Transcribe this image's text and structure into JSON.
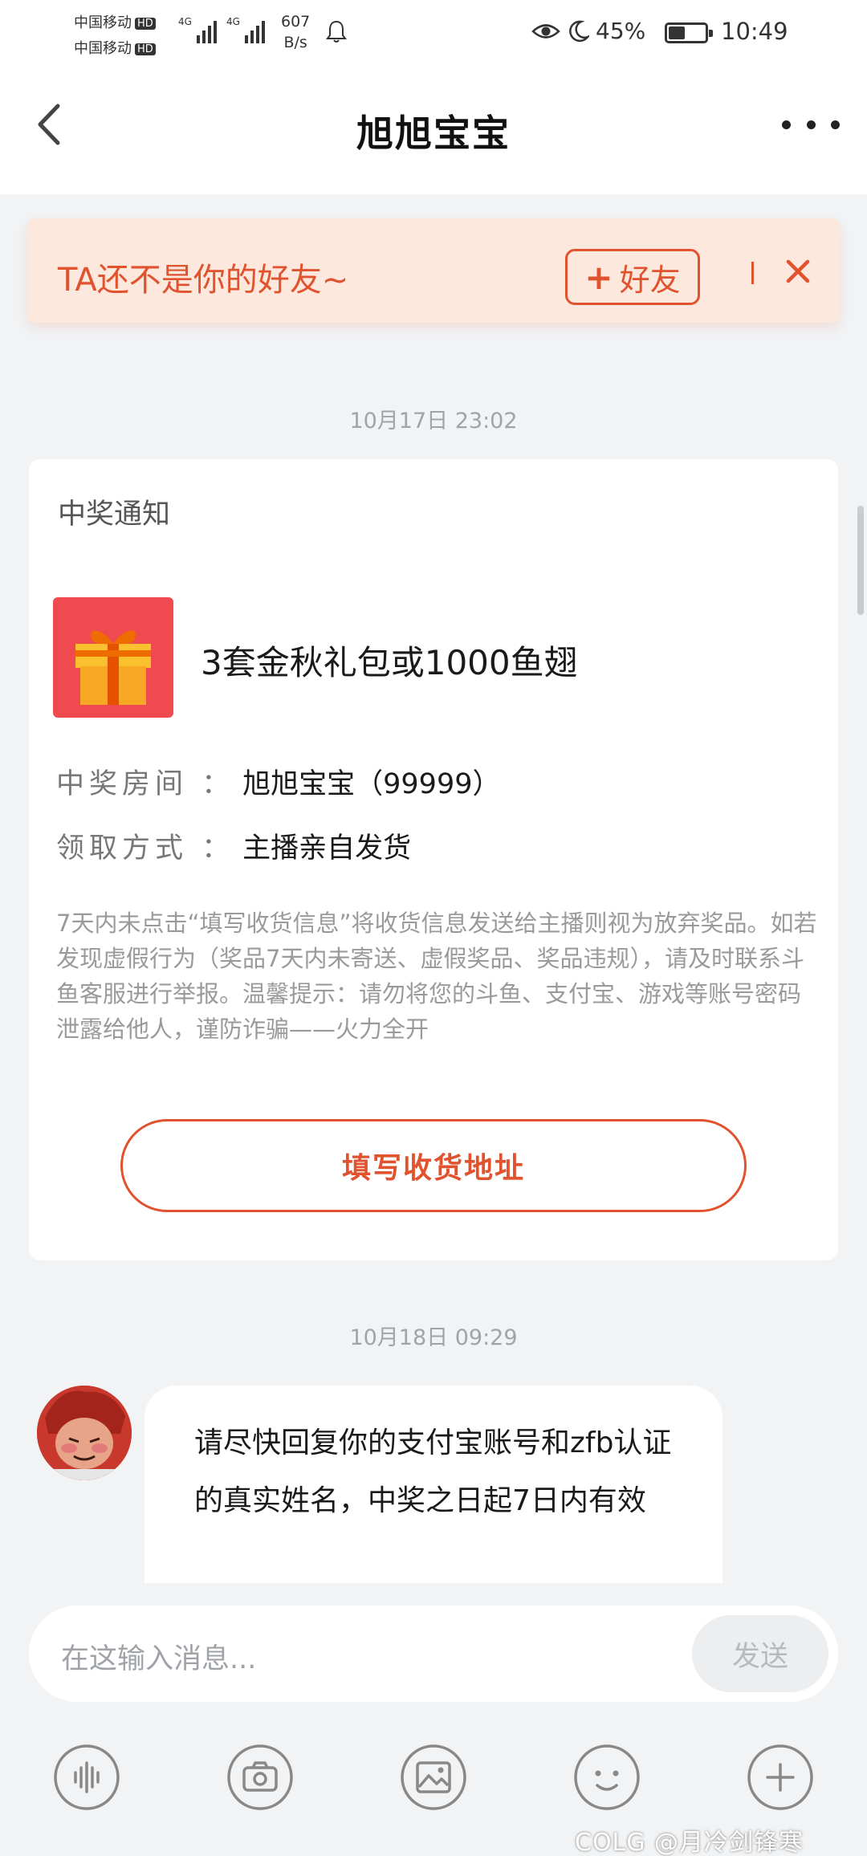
{
  "status_bar": {
    "carrier_1": "中国移动",
    "carrier_2": "中国移动",
    "hd_label": "HD",
    "network_label_1": "4G",
    "network_label_2": "4G",
    "net_speed_value": "607",
    "net_speed_unit": "B/s",
    "battery_percent": "45%",
    "battery_level": 0.45,
    "time": "10:49"
  },
  "header": {
    "title": "旭旭宝宝"
  },
  "friend_banner": {
    "text": "TA还不是你的好友~",
    "add_button_label": "好友"
  },
  "messages": {
    "timestamp_1": "10月17日 23:02",
    "timestamp_2": "10月18日 09:29"
  },
  "prize_card": {
    "title": "中奖通知",
    "prize_name": "3套金秋礼包或1000鱼翅",
    "room_label": "中奖房间 ：",
    "room_value": "旭旭宝宝（99999）",
    "method_label": "领取方式 ：",
    "method_value": "主播亲自发货",
    "notice": "7天内未点击“填写收货信息”将收货信息发送给主播则视为放弃奖品。如若发现虚假行为（奖品7天内未寄送、虚假奖品、奖品违规），请及时联系斗鱼客服进行举报。温馨提示：请勿将您的斗鱼、支付宝、游戏等账号密码泄露给他人，谨防诈骗——火力全开",
    "button_label": "填写收货地址"
  },
  "chat_message": {
    "text": "请尽快回复你的支付宝账号和zfb认证的真实姓名，中奖之日起7日内有效"
  },
  "input_bar": {
    "placeholder": "在这输入消息...",
    "send_label": "发送"
  },
  "toolbar": {
    "icons": [
      "voice-icon",
      "camera-icon",
      "image-icon",
      "emoji-icon",
      "plus-icon"
    ]
  },
  "watermark": "COLG @月冷剑锋寒",
  "colors": {
    "accent": "#e0532e",
    "banner_bg": "#fde8dd",
    "page_bg": "#f1f3f5"
  }
}
